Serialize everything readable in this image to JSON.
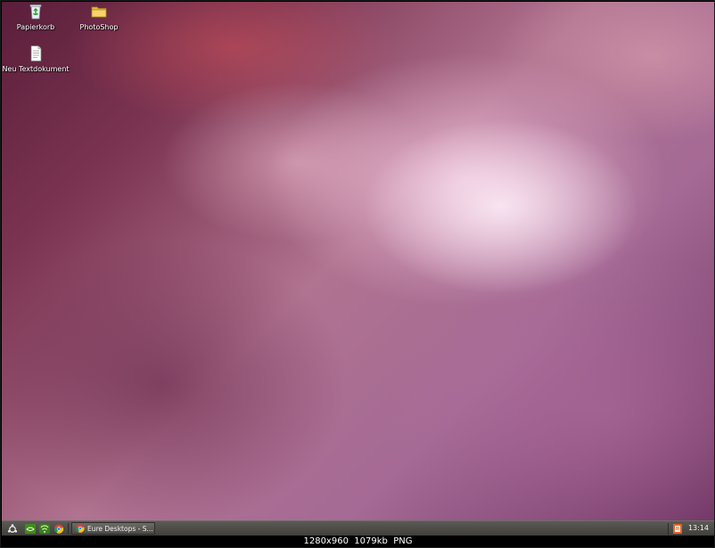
{
  "desktop": {
    "icons": [
      {
        "label": "Papierkorb",
        "icon": "recycle-bin-icon"
      },
      {
        "label": "PhotoShop",
        "icon": "folder-icon"
      },
      {
        "label": "Neu Textdokument",
        "icon": "text-document-icon"
      }
    ]
  },
  "taskbar": {
    "start_icon": "ubuntu-logo-icon",
    "quick_launch": [
      "nvidia-icon",
      "rss-feed-icon",
      "chrome-icon"
    ],
    "window_button": {
      "label": "Eure Desktops - S...",
      "icon": "chrome-icon"
    },
    "tray_icon": "tray-app-icon",
    "clock": "13:14"
  },
  "info_bar": {
    "text": "1280x960  1079kb  PNG"
  },
  "colors": {
    "taskbar": "#4d4c48",
    "accent_orange": "#e0662a"
  }
}
